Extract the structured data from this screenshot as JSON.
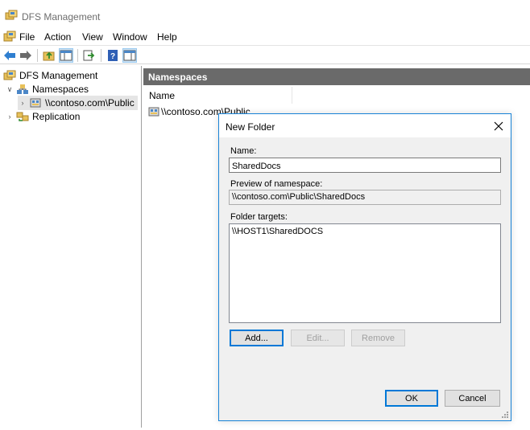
{
  "window": {
    "title": "DFS Management",
    "app_icon": "dfs-app-icon"
  },
  "menubar": {
    "items": [
      "File",
      "Action",
      "View",
      "Window",
      "Help"
    ]
  },
  "toolbar": {
    "buttons": [
      "back-arrow-icon",
      "forward-arrow-icon",
      "up-folder-icon",
      "show-hide-tree-icon",
      "export-list-icon",
      "help-icon",
      "show-action-pane-icon"
    ]
  },
  "tree": {
    "root": "DFS Management",
    "namespaces": "Namespaces",
    "namespace_item": "\\\\contoso.com\\Public",
    "replication": "Replication"
  },
  "content": {
    "header": "Namespaces",
    "column_name": "Name",
    "rows": [
      "\\\\contoso.com\\Public"
    ]
  },
  "dialog": {
    "title": "New Folder",
    "name_label": "Name:",
    "name_value": "SharedDocs",
    "preview_label": "Preview of namespace:",
    "preview_value": "\\\\contoso.com\\Public\\SharedDocs",
    "targets_label": "Folder targets:",
    "targets": [
      "\\\\HOST1\\SharedDOCS"
    ],
    "add_label": "Add...",
    "edit_label": "Edit...",
    "remove_label": "Remove",
    "ok_label": "OK",
    "cancel_label": "Cancel"
  },
  "colors": {
    "accent": "#0078d7",
    "header_bg": "#6a6a6a",
    "dialog_bg": "#f0f0f0"
  }
}
